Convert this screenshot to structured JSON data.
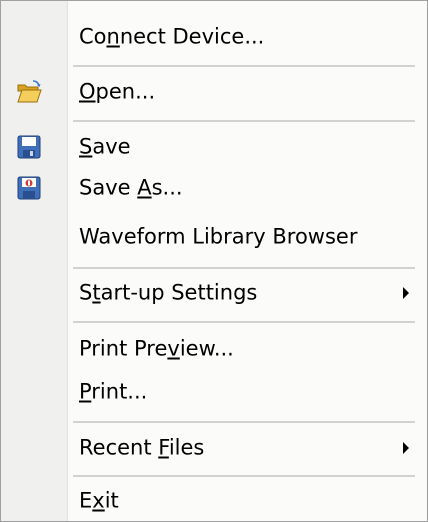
{
  "menu": {
    "items": [
      {
        "pre": "Co",
        "ul": "n",
        "post": "nect Device..."
      },
      {
        "pre": "",
        "ul": "O",
        "post": "pen..."
      },
      {
        "pre": "",
        "ul": "S",
        "post": "ave"
      },
      {
        "pre": "Save ",
        "ul": "A",
        "post": "s..."
      },
      {
        "pre": "Waveform Library Browser",
        "ul": "",
        "post": ""
      },
      {
        "pre": "S",
        "ul": "t",
        "post": "art-up Settings"
      },
      {
        "pre": "Print Pre",
        "ul": "v",
        "post": "iew..."
      },
      {
        "pre": "",
        "ul": "P",
        "post": "rint..."
      },
      {
        "pre": "Recent ",
        "ul": "F",
        "post": "iles"
      },
      {
        "pre": "E",
        "ul": "x",
        "post": "it"
      }
    ]
  },
  "icons": {
    "open": "folder-open-icon",
    "save": "floppy-disk-icon",
    "save_as": "floppy-save-as-icon",
    "submenu": "submenu-arrow-icon"
  },
  "colors": {
    "gutter": "#f0f0ee",
    "background": "#fbfbfa",
    "separator": "#d2d2d2",
    "folder": "#e8b93a",
    "floppy": "#3f6fb8"
  }
}
